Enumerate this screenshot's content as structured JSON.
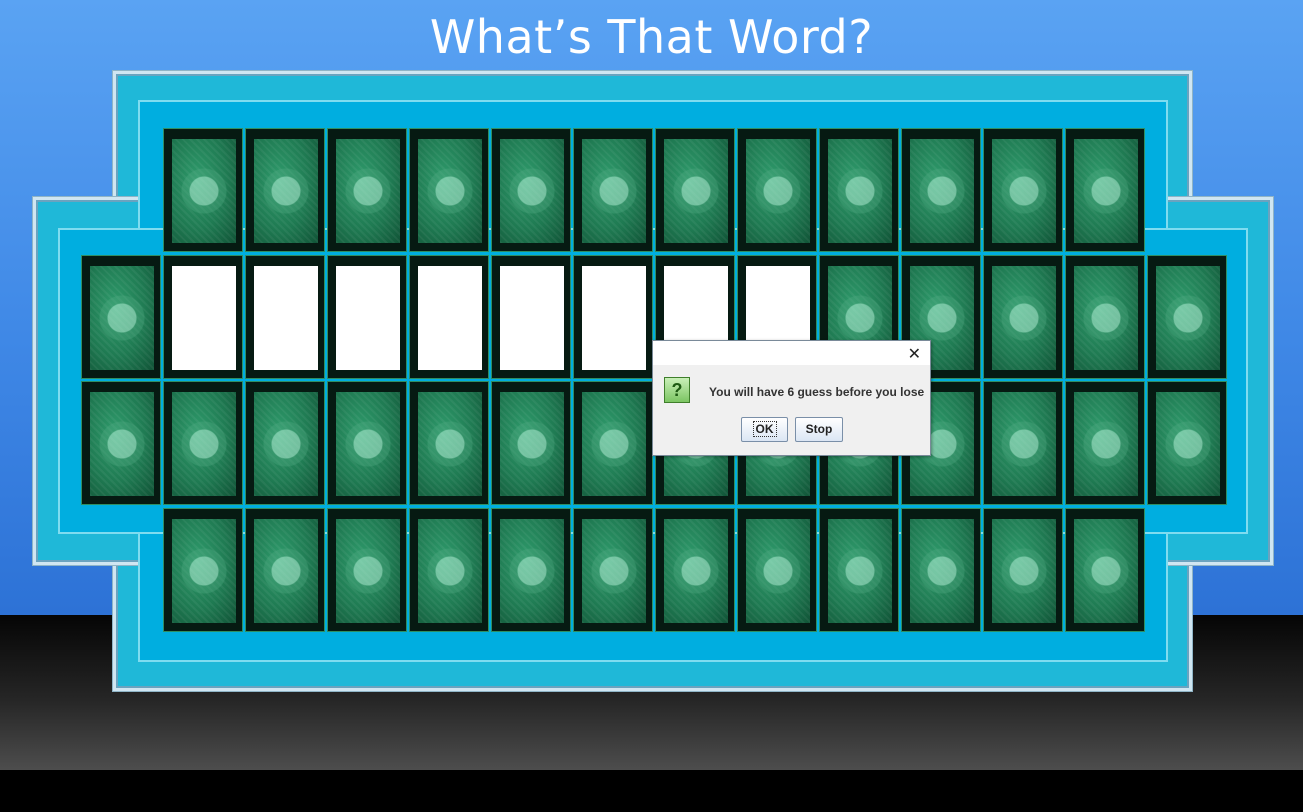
{
  "title": "What’s That Word?",
  "board": {
    "rows": [
      {
        "columns": 12,
        "blank": []
      },
      {
        "columns": 14,
        "blank": [
          1,
          2,
          3,
          4,
          5,
          6,
          7,
          8
        ]
      },
      {
        "columns": 14,
        "blank": []
      },
      {
        "columns": 12,
        "blank": []
      }
    ]
  },
  "dialog": {
    "message": "You will have 6 guess before you lose",
    "ok_label": "OK",
    "stop_label": "Stop",
    "close_glyph": "✕",
    "icon_glyph": "?"
  },
  "colors": {
    "sky": "#4a95ee",
    "board_frame": "#1fb8d8",
    "tile_face": "#1f7a52",
    "blank_tile": "#ffffff"
  }
}
